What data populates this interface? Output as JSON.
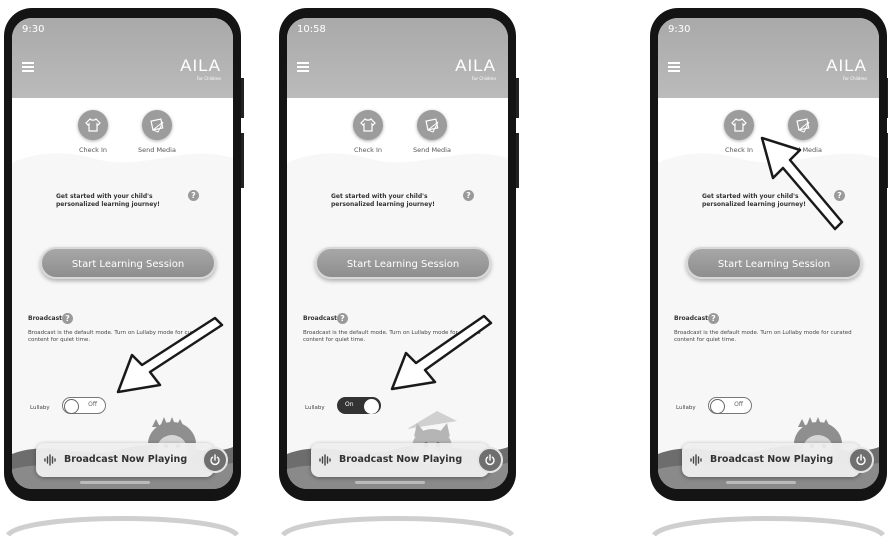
{
  "phones": [
    {
      "time": "9:30",
      "logo": "AILA",
      "logo_sub": "For Children",
      "check_in_label": "Check In",
      "send_media_label": "Send Media",
      "intro_text": "Get started with your child's personalized learning journey!",
      "start_button_label": "Start Learning Session",
      "broadcast_title": "Broadcast",
      "broadcast_desc": "Broadcast is the default mode. Turn on Lullaby mode for curated content for quiet time.",
      "lullaby_label": "Lullaby",
      "toggle_text": "Off",
      "toggle_state": "off",
      "character": "hedgehog",
      "playbar_label": "Broadcast Now Playing",
      "arrow_target": "lullaby-toggle"
    },
    {
      "time": "10:58",
      "logo": "AILA",
      "logo_sub": "For Children",
      "check_in_label": "Check In",
      "send_media_label": "Send Media",
      "intro_text": "Get started with your child's personalized learning journey!",
      "start_button_label": "Start Learning Session",
      "broadcast_title": "Broadcast",
      "broadcast_desc": "Broadcast is the default mode. Turn on Lullaby mode for curated content for quiet time.",
      "lullaby_label": "Lullaby",
      "toggle_text": "On",
      "toggle_state": "on",
      "character": "cat",
      "playbar_label": "Broadcast Now Playing",
      "arrow_target": "lullaby-toggle"
    },
    {
      "time": "9:30",
      "logo": "AILA",
      "logo_sub": "For Children",
      "check_in_label": "Check In",
      "send_media_label": "Send Media",
      "intro_text": "Get started with your child's personalized learning journey!",
      "start_button_label": "Start Learning Session",
      "broadcast_title": "Broadcast",
      "broadcast_desc": "Broadcast is the default mode. Turn on Lullaby mode for curated content for quiet time.",
      "lullaby_label": "Lullaby",
      "toggle_text": "Off",
      "toggle_state": "off",
      "character": "hedgehog",
      "playbar_label": "Broadcast Now Playing",
      "arrow_target": "check-in-button"
    }
  ],
  "colors": {
    "header": "#b3b3b3",
    "bezel": "#141414",
    "button": "#9a9a9a",
    "arrow": "#1a1a1a"
  }
}
